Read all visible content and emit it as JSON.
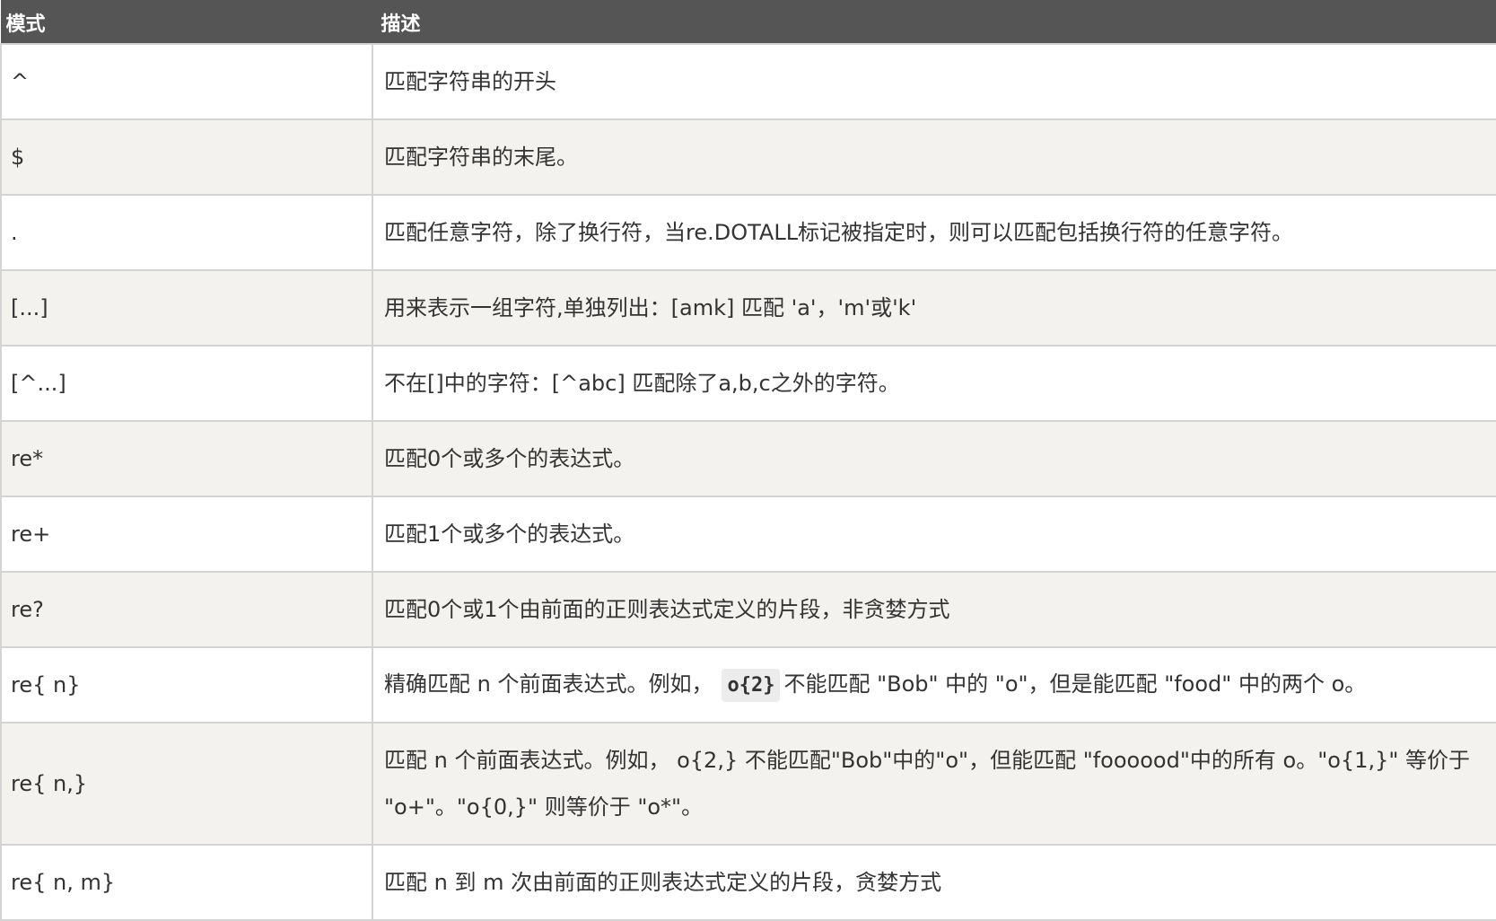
{
  "table": {
    "headers": {
      "pattern": "模式",
      "description": "描述"
    },
    "rows": [
      {
        "pattern": "^",
        "description": "匹配字符串的开头"
      },
      {
        "pattern": "$",
        "description": "匹配字符串的末尾。"
      },
      {
        "pattern": ".",
        "description": "匹配任意字符，除了换行符，当re.DOTALL标记被指定时，则可以匹配包括换行符的任意字符。"
      },
      {
        "pattern": "[...]",
        "description": "用来表示一组字符,单独列出：[amk] 匹配 'a'，'m'或'k'"
      },
      {
        "pattern": "[^...]",
        "description": "不在[]中的字符：[^abc] 匹配除了a,b,c之外的字符。"
      },
      {
        "pattern": "re*",
        "description": "匹配0个或多个的表达式。"
      },
      {
        "pattern": "re+",
        "description": "匹配1个或多个的表达式。"
      },
      {
        "pattern": "re?",
        "description": "匹配0个或1个由前面的正则表达式定义的片段，非贪婪方式"
      },
      {
        "pattern": "re{ n}",
        "description_before": "精确匹配 n 个前面表达式。例如，",
        "description_code": "o{2}",
        "description_after": "不能匹配 \"Bob\" 中的 \"o\"，但是能匹配 \"food\" 中的两个 o。"
      },
      {
        "pattern": "re{ n,}",
        "description": "匹配 n 个前面表达式。例如， o{2,} 不能匹配\"Bob\"中的\"o\"，但能匹配 \"foooood\"中的所有 o。\"o{1,}\" 等价于 \"o+\"。\"o{0,}\" 则等价于 \"o*\"。"
      },
      {
        "pattern": "re{ n, m}",
        "description": "匹配 n 到 m 次由前面的正则表达式定义的片段，贪婪方式"
      }
    ]
  }
}
